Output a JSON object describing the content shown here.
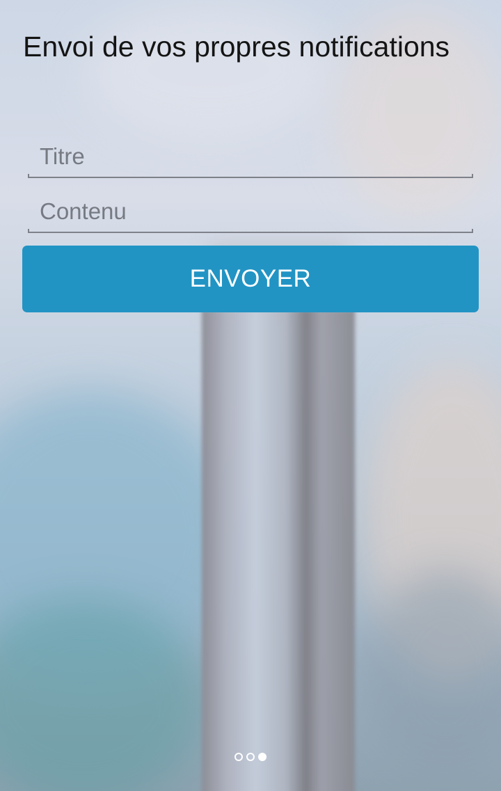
{
  "page": {
    "title": "Envoi de vos propres notifications"
  },
  "form": {
    "title_placeholder": "Titre",
    "title_value": "",
    "content_placeholder": "Contenu",
    "content_value": "",
    "submit_label": "ENVOYER"
  },
  "pager": {
    "total": 3,
    "current": 3
  },
  "colors": {
    "accent": "#2194c4",
    "title_text": "#141414",
    "placeholder": "#767a82",
    "underline": "#7e8189"
  }
}
